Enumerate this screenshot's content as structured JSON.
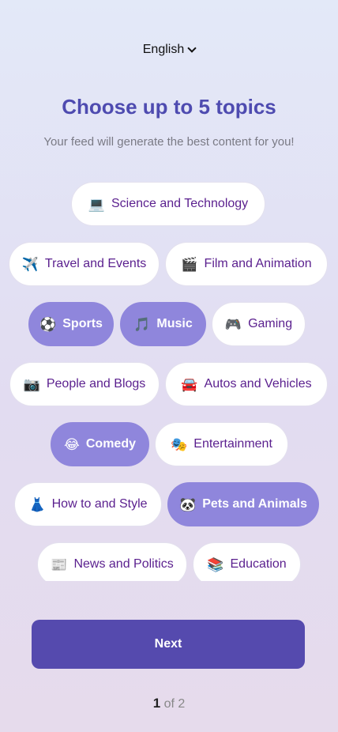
{
  "language": {
    "label": "English",
    "icon": "chevron-down-icon"
  },
  "header": {
    "title": "Choose up to 5 topics",
    "subtitle": "Your feed will generate the best content for you!"
  },
  "topics": [
    {
      "emoji": "💻",
      "label": "Science and Technology",
      "selected": false
    },
    {
      "emoji": "✈️",
      "label": "Travel and Events",
      "selected": false
    },
    {
      "emoji": "🎬",
      "label": "Film and Animation",
      "selected": false
    },
    {
      "emoji": "⚽",
      "label": "Sports",
      "selected": true
    },
    {
      "emoji": "🎵",
      "label": "Music",
      "selected": true
    },
    {
      "emoji": "🎮",
      "label": "Gaming",
      "selected": false
    },
    {
      "emoji": "📷",
      "label": "People and Blogs",
      "selected": false
    },
    {
      "emoji": "🚘",
      "label": "Autos and Vehicles",
      "selected": false
    },
    {
      "emoji": "😂",
      "label": "Comedy",
      "selected": true
    },
    {
      "emoji": "🎭",
      "label": "Entertainment",
      "selected": false
    },
    {
      "emoji": "👗",
      "label": "How to and Style",
      "selected": false
    },
    {
      "emoji": "🐼",
      "label": "Pets and Animals",
      "selected": true
    },
    {
      "emoji": "📰",
      "label": "News and Politics",
      "selected": false
    },
    {
      "emoji": "📚",
      "label": "Education",
      "selected": false
    }
  ],
  "footer": {
    "next_label": "Next",
    "pager_current": "1",
    "pager_rest": "of 2"
  },
  "colors": {
    "accent": "#554aae",
    "selected_chip": "#8f86dc",
    "chip_text": "#5a1f8e",
    "title": "#4e4bb0"
  }
}
